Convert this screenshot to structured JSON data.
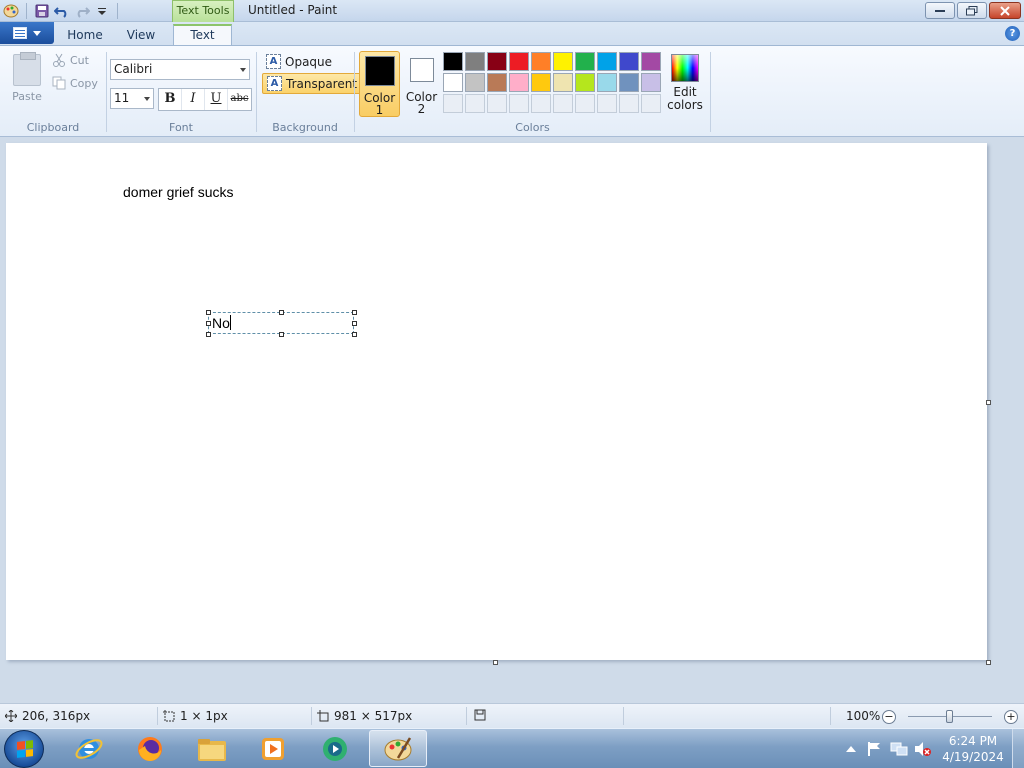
{
  "window": {
    "title": "Untitled - Paint",
    "context_tab": "Text Tools"
  },
  "tabs": [
    {
      "label": "Home"
    },
    {
      "label": "View"
    },
    {
      "label": "Text"
    }
  ],
  "clipboard": {
    "paste": "Paste",
    "cut": "Cut",
    "copy": "Copy",
    "group_label": "Clipboard"
  },
  "font": {
    "family": "Calibri",
    "size": "11",
    "bold": "B",
    "italic": "I",
    "underline": "U",
    "strikethrough": "abc",
    "group_label": "Font"
  },
  "background": {
    "opaque": "Opaque",
    "transparent": "Transparent",
    "selected": "Transparent",
    "group_label": "Background"
  },
  "colors": {
    "color1_label": "Color",
    "color1_num": "1",
    "color2_label": "Color",
    "color2_num": "2",
    "color1_value": "#000000",
    "color2_value": "#ffffff",
    "edit_label": "Edit",
    "edit_label2": "colors",
    "group_label": "Colors",
    "palette_row1": [
      "#000000",
      "#7f7f7f",
      "#880015",
      "#ed1c24",
      "#ff7f27",
      "#fff200",
      "#22b14c",
      "#00a2e8",
      "#3f48cc",
      "#a349a4"
    ],
    "palette_row2": [
      "#ffffff",
      "#c3c3c3",
      "#b97a57",
      "#ffaec9",
      "#ffc90e",
      "#efe4b0",
      "#b5e61d",
      "#99d9ea",
      "#7092be",
      "#c8bfe7"
    ]
  },
  "canvas": {
    "text1": "domer grief sucks",
    "textbox_value": "No"
  },
  "status": {
    "cursor_pos": "206, 316px",
    "selection_size": "1 × 1px",
    "canvas_size": "981 × 517px",
    "zoom": "100%"
  },
  "taskbar": {
    "time": "6:24 PM",
    "date": "4/19/2024"
  }
}
